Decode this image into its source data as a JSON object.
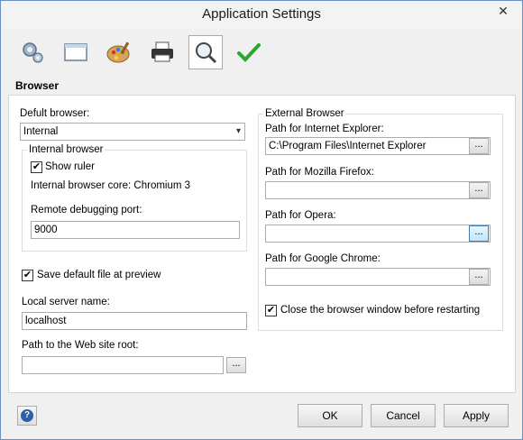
{
  "window": {
    "title": "Application Settings",
    "close": "✕"
  },
  "toolbar": {
    "items": [
      {
        "icon": "gear-icon"
      },
      {
        "icon": "window-icon"
      },
      {
        "icon": "palette-icon"
      },
      {
        "icon": "printer-icon"
      },
      {
        "icon": "magnifier-icon",
        "active": true
      },
      {
        "icon": "checkmark-icon"
      }
    ]
  },
  "section": {
    "title": "Browser"
  },
  "left": {
    "default_browser_label": "Defult browser:",
    "default_browser_value": "Internal",
    "internal_group_title": "Internal browser",
    "show_ruler_label": "Show ruler",
    "show_ruler_checked": true,
    "core_text": "Internal browser core: Chromium 3",
    "debug_port_label": "Remote debugging port:",
    "debug_port_value": "9000",
    "save_default_label": "Save default file at preview",
    "save_default_checked": true,
    "server_name_label": "Local server name:",
    "server_name_value": "localhost",
    "site_root_label": "Path to the Web site root:",
    "site_root_value": ""
  },
  "right": {
    "group_title": "External Browser",
    "ie_label": "Path for Internet Explorer:",
    "ie_value": "C:\\Program Files\\Internet Explorer",
    "firefox_label": "Path for Mozilla Firefox:",
    "firefox_value": "",
    "opera_label": "Path for Opera:",
    "opera_value": "",
    "chrome_label": "Path for Google Chrome:",
    "chrome_value": "",
    "close_browser_label": "Close the browser window before restarting",
    "close_browser_checked": true,
    "browse_label": "..."
  },
  "buttons": {
    "ok": "OK",
    "cancel": "Cancel",
    "apply": "Apply",
    "help": "?"
  },
  "check_mark": "✔",
  "dropdown_arrow": "▾"
}
